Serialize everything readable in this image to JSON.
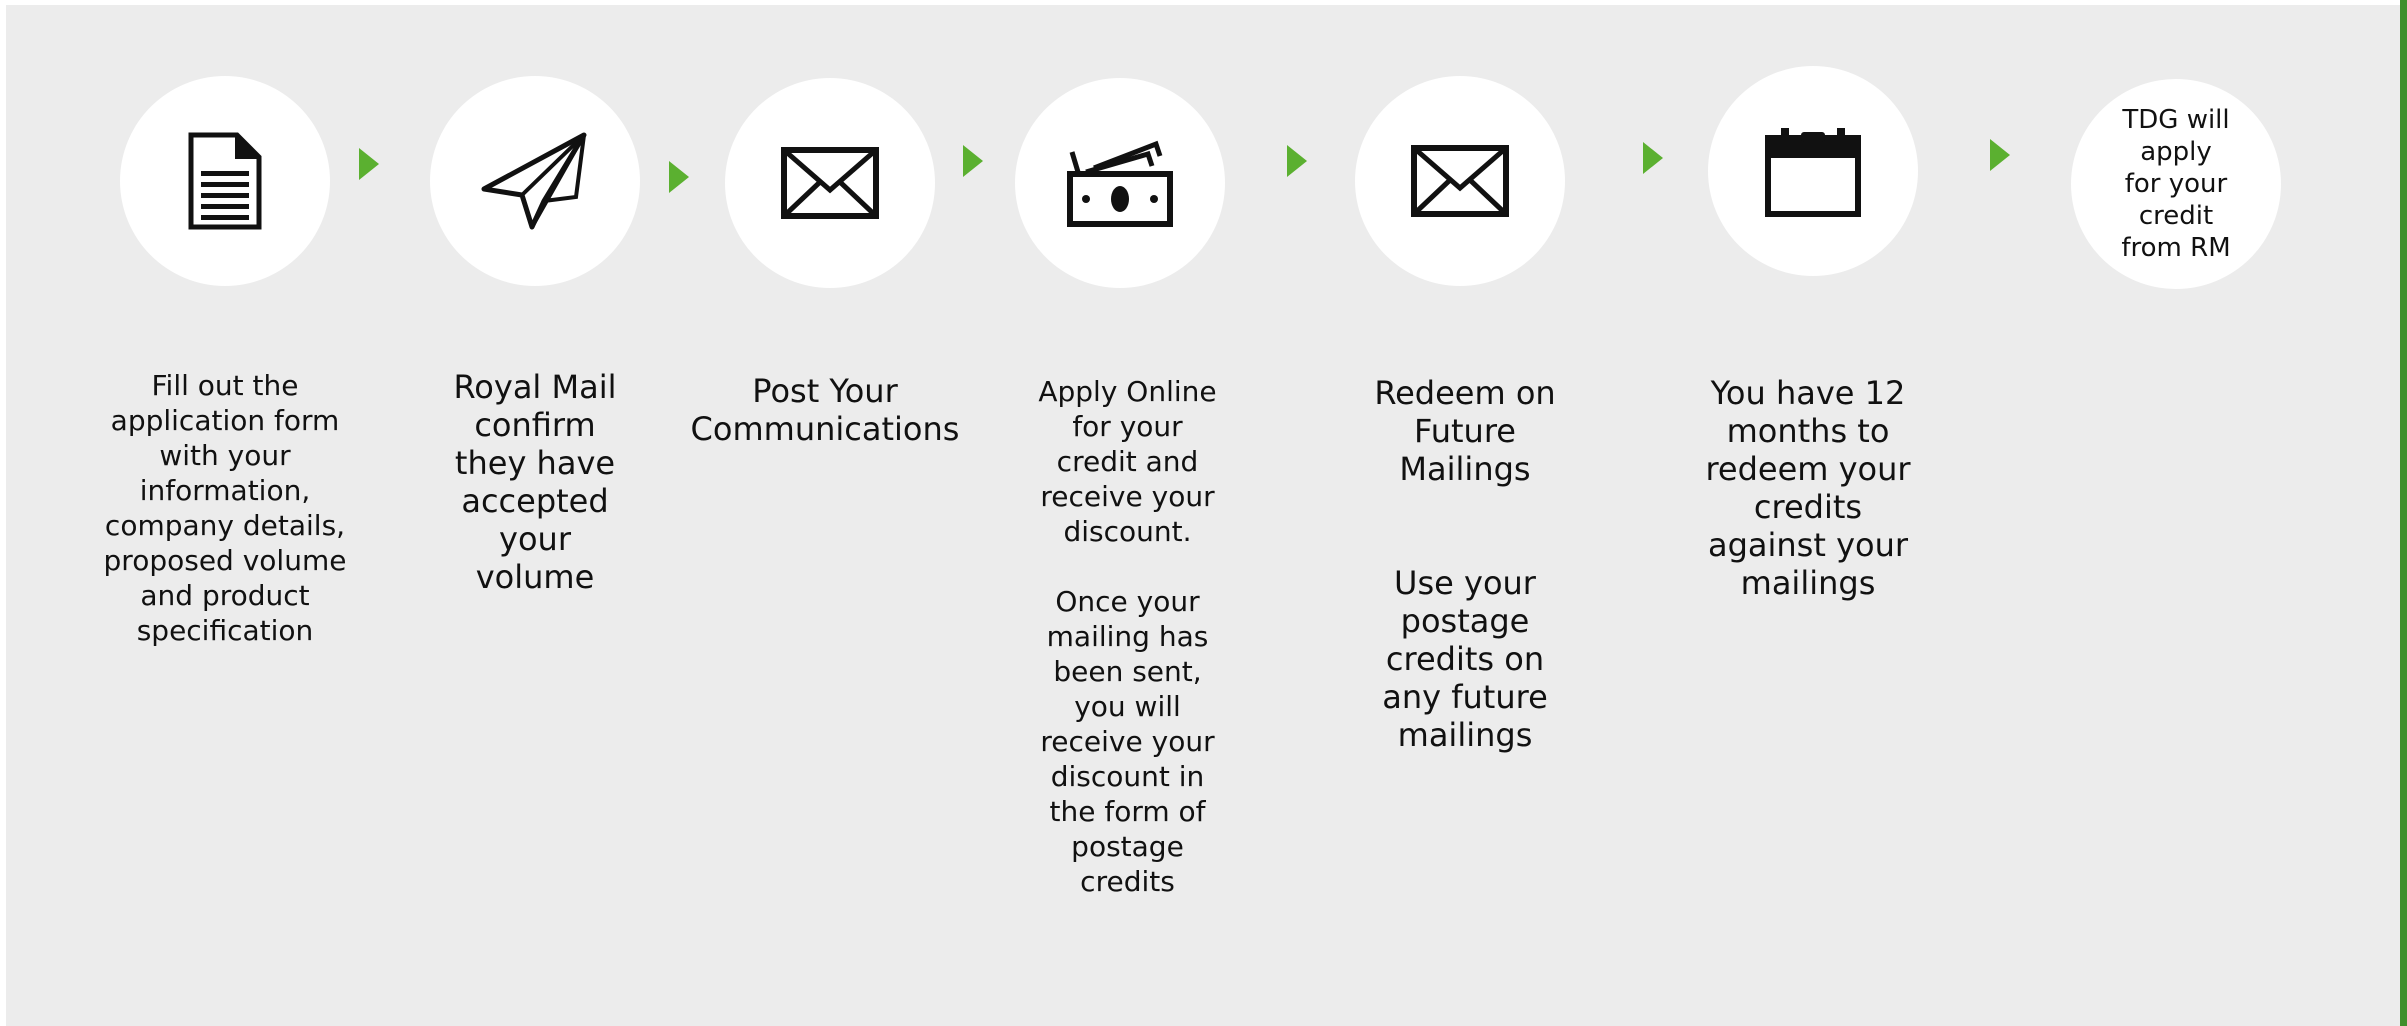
{
  "steps": [
    {
      "icon": "document-icon",
      "text": "Fill out the\napplication form\nwith your\ninformation,\ncompany details,\nproposed volume\nand product\nspecification"
    },
    {
      "icon": "paper-plane-icon",
      "text": "Royal Mail\nconfirm\nthey have\naccepted\nyour\nvolume"
    },
    {
      "icon": "envelope-icon",
      "text": "Post Your\nCommunications"
    },
    {
      "icon": "cash-icon",
      "text": "Apply Online\nfor your\ncredit and\nreceive your\ndiscount.\n\nOnce your\nmailing has\nbeen  sent,\nyou will\nreceive your\ndiscount in\nthe form of\npostage\ncredits"
    },
    {
      "icon": "envelope-icon",
      "text": "Redeem on\nFuture\nMailings\n\n\nUse your\npostage\ncredits on\nany future\nmailings"
    },
    {
      "icon": "calendar-icon",
      "text": "You have 12\nmonths to\nredeem your\ncredits\nagainst your\nmailings"
    },
    {
      "icon": "",
      "text": "TDG will\napply\nfor your\ncredit\nfrom RM"
    }
  ],
  "colors": {
    "background": "#ececec",
    "circle": "#ffffff",
    "arrow": "#5bb030",
    "accent_bar": "#3f8f2b",
    "icon": "#111111"
  }
}
